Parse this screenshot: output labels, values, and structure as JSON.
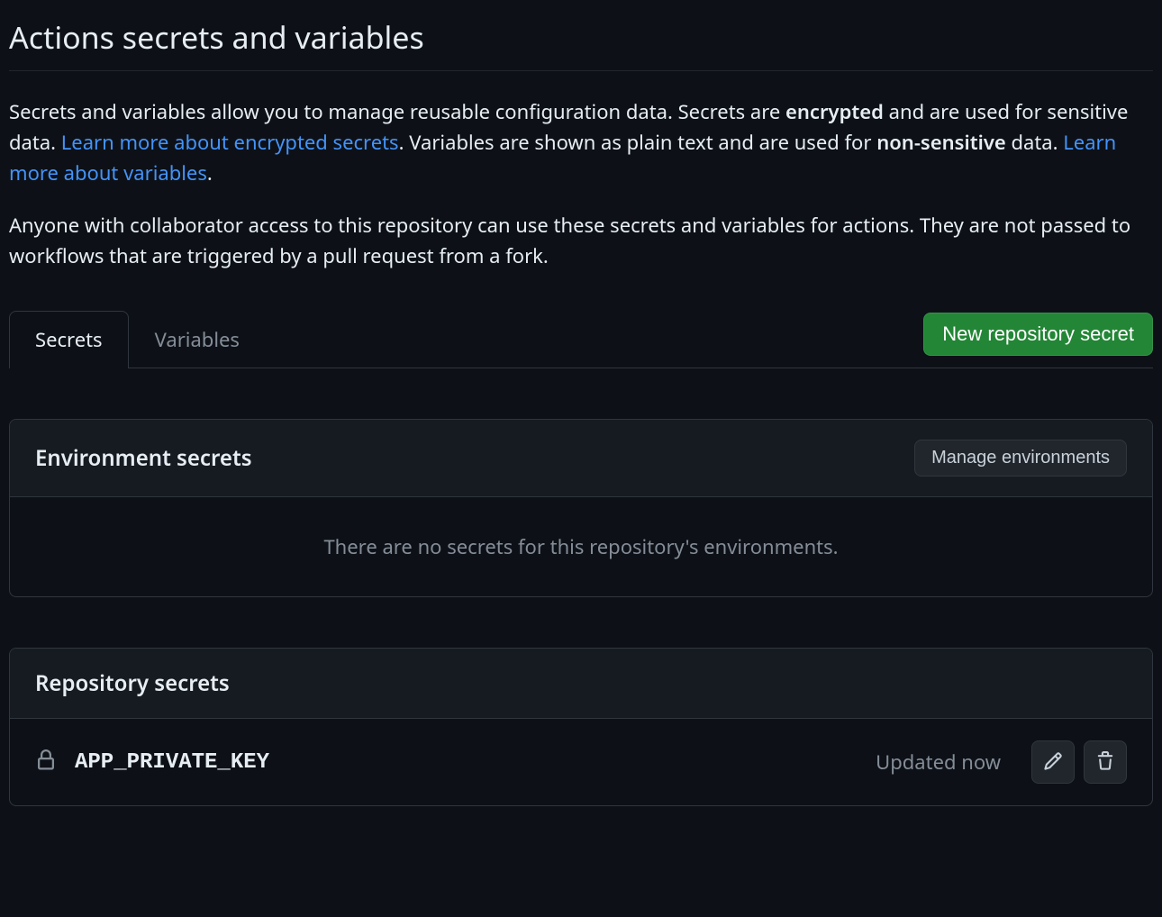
{
  "header": {
    "title": "Actions secrets and variables"
  },
  "description": {
    "intro_1": "Secrets and variables allow you to manage reusable configuration data. Secrets are ",
    "encrypted_strong": "encrypted",
    "intro_2": " and are used for sensitive data. ",
    "link_secrets": "Learn more about encrypted secrets",
    "period1": ".",
    "intro_3": " Variables are shown as plain text and are used for ",
    "nonsensitive_strong": "non-sensitive",
    "intro_4": " data. ",
    "link_variables": "Learn more about variables",
    "period2": ".",
    "paragraph2": "Anyone with collaborator access to this repository can use these secrets and variables for actions. They are not passed to workflows that are triggered by a pull request from a fork."
  },
  "tabs": {
    "secrets": "Secrets",
    "variables": "Variables"
  },
  "buttons": {
    "new_secret": "New repository secret",
    "manage_environments": "Manage environments"
  },
  "env_panel": {
    "title": "Environment secrets",
    "empty_message": "There are no secrets for this repository's environments."
  },
  "repo_panel": {
    "title": "Repository secrets",
    "secrets": [
      {
        "name": "APP_PRIVATE_KEY",
        "updated": "Updated now"
      }
    ]
  }
}
